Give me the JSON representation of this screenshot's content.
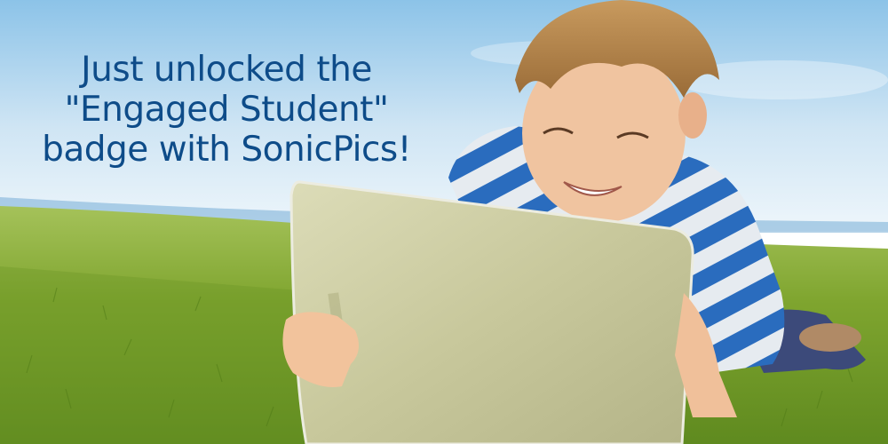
{
  "headline": {
    "line1": "Just unlocked the",
    "line2": "\"Engaged Student\"",
    "line3": "badge with SonicPics!"
  },
  "colors": {
    "headline": "#0e4c89",
    "sky_top": "#8ec4e8",
    "sky_bottom": "#e8f3fa",
    "grass": "#7aa12a",
    "shirt_stripe_blue": "#2a6ec0",
    "shirt_stripe_white": "#e8edf2",
    "tablet_back": "#c9c9a0"
  },
  "scene": {
    "subject": "boy-lying-on-grass-using-tablet"
  }
}
